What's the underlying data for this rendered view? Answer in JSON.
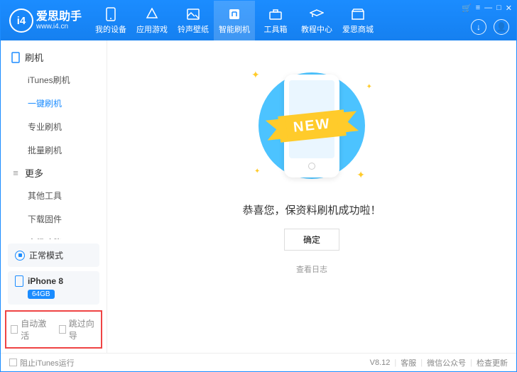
{
  "header": {
    "logo_text": "i4",
    "brand": "爱思助手",
    "url": "www.i4.cn",
    "nav": [
      {
        "label": "我的设备"
      },
      {
        "label": "应用游戏"
      },
      {
        "label": "铃声壁纸"
      },
      {
        "label": "智能刷机"
      },
      {
        "label": "工具箱"
      },
      {
        "label": "教程中心"
      },
      {
        "label": "爱思商城"
      }
    ]
  },
  "sidebar": {
    "section1_title": "刷机",
    "section1_items": [
      "iTunes刷机",
      "一键刷机",
      "专业刷机",
      "批量刷机"
    ],
    "section2_title": "更多",
    "section2_items": [
      "其他工具",
      "下载固件",
      "高级功能"
    ],
    "status_mode": "正常模式",
    "device_name": "iPhone 8",
    "device_storage": "64GB",
    "cb_auto_activate": "自动激活",
    "cb_skip_guide": "跳过向导"
  },
  "main": {
    "ribbon": "NEW",
    "message": "恭喜您，保资料刷机成功啦！",
    "confirm": "确定",
    "log_link": "查看日志"
  },
  "footer": {
    "block_itunes": "阻止iTunes运行",
    "version": "V8.12",
    "support": "客服",
    "wechat": "微信公众号",
    "check_update": "检查更新"
  }
}
